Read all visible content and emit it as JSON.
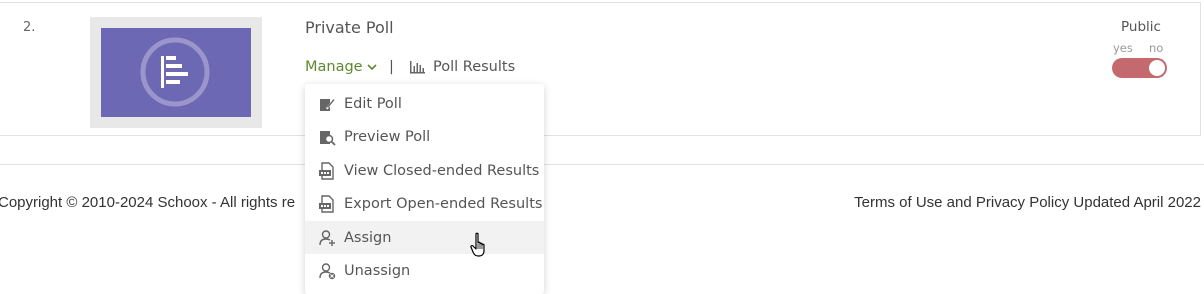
{
  "row": {
    "number": "2.",
    "title": "Private Poll",
    "manage_label": "Manage",
    "separator": "|",
    "results_label": "Poll Results",
    "thumbnail_icon": "bar-chart-circle-icon",
    "public": {
      "label": "Public",
      "yes": "yes",
      "no": "no",
      "state": "no"
    }
  },
  "dropdown": {
    "items": [
      {
        "label": "Edit Poll",
        "icon": "edit-icon"
      },
      {
        "label": "Preview Poll",
        "icon": "preview-icon"
      },
      {
        "label": "View Closed-ended Results",
        "icon": "pdf-file-icon"
      },
      {
        "label": "Export Open-ended Results",
        "icon": "csv-file-icon"
      },
      {
        "label": "Assign",
        "icon": "user-add-icon"
      },
      {
        "label": "Unassign",
        "icon": "user-remove-icon"
      }
    ]
  },
  "footer": {
    "copyright": "Copyright © 2010-2024 Schoox - All rights re",
    "terms": "Terms of Use and Privacy Policy Updated April 2022"
  },
  "colors": {
    "thumbnail": "#6d68b3",
    "manage_link": "#5e8a2f",
    "toggle_off": "#c46a6e"
  }
}
